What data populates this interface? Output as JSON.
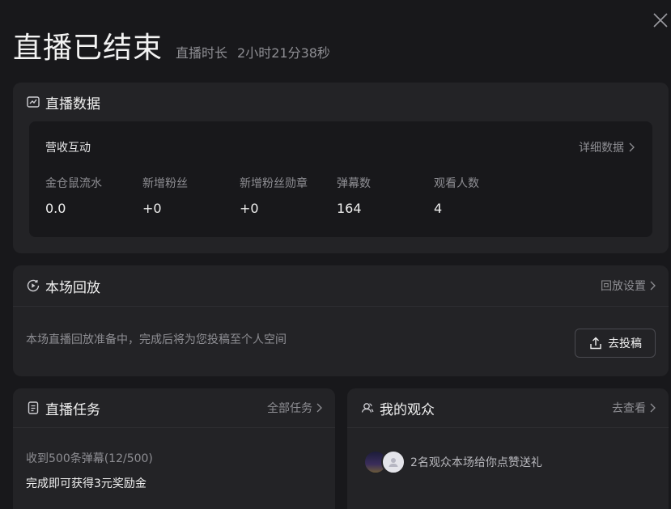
{
  "header": {
    "title": "直播已结束",
    "duration_label": "直播时长",
    "duration_value": "2小时21分38秒"
  },
  "live_data": {
    "title": "直播数据",
    "section_title": "营收互动",
    "detail_link": "详细数据",
    "stats": [
      {
        "label": "金仓鼠流水",
        "value": "0.0"
      },
      {
        "label": "新增粉丝",
        "value": "+0"
      },
      {
        "label": "新增粉丝勋章",
        "value": "+0"
      },
      {
        "label": "弹幕数",
        "value": "164"
      },
      {
        "label": "观看人数",
        "value": "4"
      }
    ]
  },
  "replay": {
    "title": "本场回放",
    "settings_link": "回放设置",
    "status_text": "本场直播回放准备中，完成后将为您投稿至个人空间",
    "upload_button": "去投稿"
  },
  "tasks": {
    "title": "直播任务",
    "all_link": "全部任务",
    "progress": "收到500条弹幕(12/500)",
    "reward": "完成即可获得3元奖励金"
  },
  "audience": {
    "title": "我的观众",
    "view_link": "去查看",
    "summary": "2名观众本场给你点赞送礼"
  }
}
